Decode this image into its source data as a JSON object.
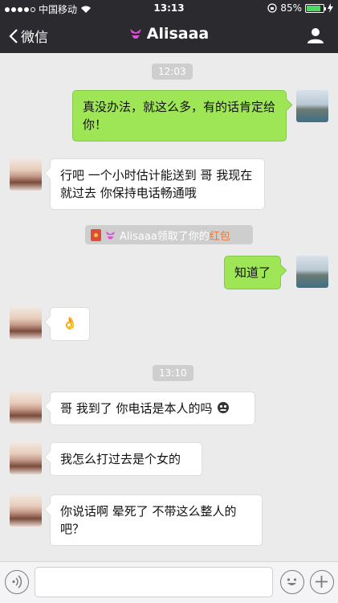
{
  "status_bar": {
    "carrier": "中国移动",
    "time": "13:13",
    "battery": "85%",
    "battery_level": 0.85
  },
  "nav": {
    "back_label": "微信",
    "title": "Alisaaa"
  },
  "chat": {
    "time_1": "12:03",
    "msg_1": "真没办法，就这么多，有的话肯定给你！",
    "msg_2": "行吧  一个小时估计能送到  哥  我现在就过去 你保持电话畅通哦",
    "system": {
      "prefix": "Alisaaa领取了你的",
      "highlight": "红包"
    },
    "msg_3": "知道了",
    "sticker": "👌",
    "time_2": "13:10",
    "msg_4": "哥  我到了  你电话是本人的吗",
    "msg_5": "我怎么打过去是个女的",
    "msg_6": "你说话啊 晕死了 不带这么整人的吧？"
  },
  "input": {
    "value": ""
  },
  "colors": {
    "nav_bg": "#2b2b2f",
    "chat_bg": "#ebebeb",
    "out_bubble": "#9ee655",
    "in_bubble": "#ffffff",
    "highlight": "#f07836"
  }
}
